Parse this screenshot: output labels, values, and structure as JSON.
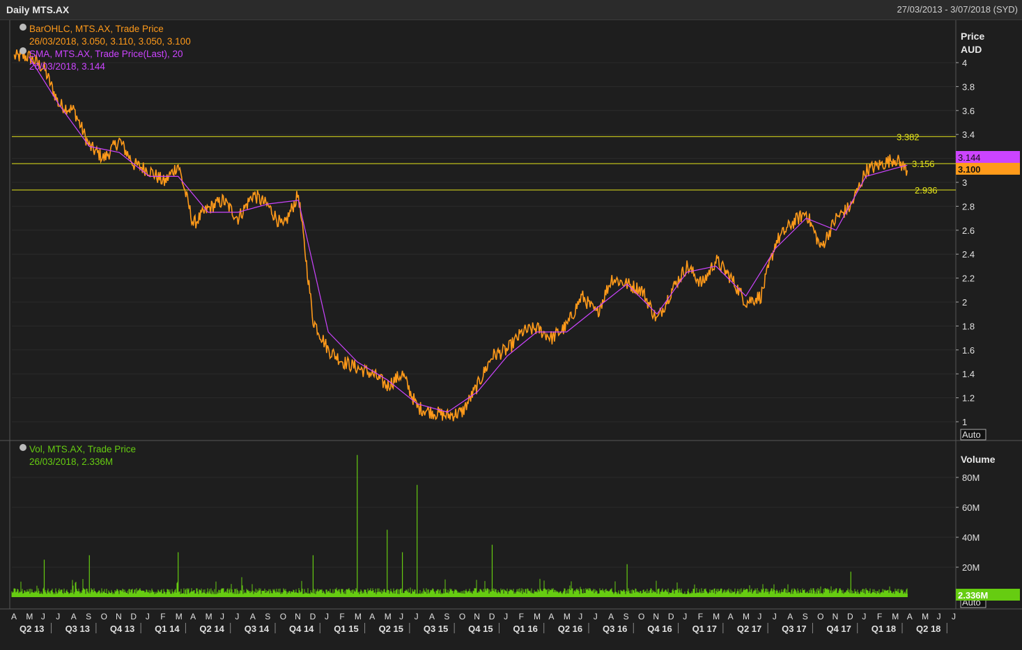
{
  "window": {
    "title": "Daily MTS.AX",
    "date_range": "27/03/2013 - 3/07/2018 (SYD)"
  },
  "colors": {
    "price": "#ff9a1a",
    "sma": "#cc44ff",
    "volume": "#66cc11",
    "hline": "#e6e61a",
    "volume_legend": "#66cc11",
    "bg": "#1e1e1e"
  },
  "price_panel": {
    "legend": {
      "ohlc_title": "BarOHLC, MTS.AX, Trade Price",
      "ohlc_values": "26/03/2018, 3.050, 3.110, 3.050, 3.100",
      "sma_title": "SMA, MTS.AX, Trade Price(Last),  20",
      "sma_values": "26/03/2018, 3.144"
    },
    "axis_title_1": "Price",
    "axis_title_2": "AUD",
    "auto_label": "Auto",
    "last_sma_tag": "3.144",
    "last_price_tag": "3.100",
    "hlines": [
      {
        "label": "3.382",
        "value": 3.382
      },
      {
        "label": "3.156",
        "value": 3.156
      },
      {
        "label": "2.936",
        "value": 2.936
      }
    ],
    "y_ticks": [
      "1",
      "1.2",
      "1.4",
      "1.6",
      "1.8",
      "2",
      "2.2",
      "2.4",
      "2.6",
      "2.8",
      "3",
      "3.2",
      "3.4",
      "3.6",
      "3.8",
      "4"
    ]
  },
  "volume_panel": {
    "legend_title": "Vol, MTS.AX, Trade Price",
    "legend_values": "26/03/2018, 2.336M",
    "axis_title": "Volume",
    "y_ticks": [
      "20M",
      "40M",
      "60M",
      "80M"
    ],
    "last_tag": "2.336M",
    "auto_label": "Auto"
  },
  "x_axis": {
    "months": [
      "A",
      "M",
      "J",
      "J",
      "A",
      "S",
      "O",
      "N",
      "D",
      "J",
      "F",
      "M",
      "A",
      "M",
      "J",
      "J",
      "A",
      "S",
      "O",
      "N",
      "D",
      "J",
      "F",
      "M",
      "A",
      "M",
      "J",
      "J",
      "A",
      "S",
      "O",
      "N",
      "D",
      "J",
      "F",
      "M",
      "A",
      "M",
      "J",
      "J",
      "A",
      "S",
      "O",
      "N",
      "D",
      "J",
      "F",
      "M",
      "A",
      "M",
      "J",
      "J",
      "A",
      "S",
      "O",
      "N",
      "D",
      "J",
      "F",
      "M",
      "A",
      "M",
      "J",
      "J"
    ],
    "quarters": [
      "Q2 13",
      "Q3 13",
      "Q4 13",
      "Q1 14",
      "Q2 14",
      "Q3 14",
      "Q4 14",
      "Q1 15",
      "Q2 15",
      "Q3 15",
      "Q4 15",
      "Q1 16",
      "Q2 16",
      "Q3 16",
      "Q4 16",
      "Q1 17",
      "Q2 17",
      "Q3 17",
      "Q4 17",
      "Q1 18",
      "Q2 18"
    ]
  },
  "chart_data": [
    {
      "type": "line",
      "title": "Daily MTS.AX",
      "ylabel": "Price AUD",
      "ylim": [
        0.95,
        4.1
      ],
      "x_range": [
        "2013-03-27",
        "2018-07-03"
      ],
      "series": [
        {
          "name": "BarOHLC, MTS.AX, Trade Price",
          "x": [
            "2013-04-01",
            "2013-05-01",
            "2013-06-01",
            "2013-07-01",
            "2013-08-01",
            "2013-09-01",
            "2013-10-01",
            "2013-11-01",
            "2013-12-01",
            "2014-01-01",
            "2014-02-01",
            "2014-03-01",
            "2014-04-01",
            "2014-05-01",
            "2014-06-01",
            "2014-07-01",
            "2014-08-01",
            "2014-09-01",
            "2014-10-01",
            "2014-11-01",
            "2014-12-01",
            "2015-01-01",
            "2015-02-01",
            "2015-03-01",
            "2015-04-01",
            "2015-05-01",
            "2015-06-01",
            "2015-07-01",
            "2015-08-01",
            "2015-09-01",
            "2015-10-01",
            "2015-11-01",
            "2015-12-01",
            "2016-01-01",
            "2016-02-01",
            "2016-03-01",
            "2016-04-01",
            "2016-05-01",
            "2016-06-01",
            "2016-07-01",
            "2016-08-01",
            "2016-09-01",
            "2016-10-01",
            "2016-11-01",
            "2016-12-01",
            "2017-01-01",
            "2017-02-01",
            "2017-03-01",
            "2017-04-01",
            "2017-05-01",
            "2017-06-01",
            "2017-07-01",
            "2017-08-01",
            "2017-09-01",
            "2017-10-01",
            "2017-11-01",
            "2017-12-01",
            "2018-01-01",
            "2018-02-01",
            "2018-03-01",
            "2018-03-26"
          ],
          "values": [
            4.3,
            4.2,
            3.95,
            3.65,
            3.6,
            3.3,
            3.2,
            3.35,
            3.15,
            3.1,
            3.0,
            3.15,
            2.65,
            2.78,
            2.85,
            2.7,
            2.9,
            2.8,
            2.62,
            2.9,
            1.85,
            1.6,
            1.5,
            1.45,
            1.4,
            1.3,
            1.4,
            1.12,
            1.08,
            1.05,
            1.08,
            1.3,
            1.55,
            1.6,
            1.75,
            1.78,
            1.7,
            1.8,
            2.05,
            1.9,
            2.2,
            2.15,
            2.1,
            1.85,
            2.1,
            2.3,
            2.15,
            2.35,
            2.2,
            2.0,
            2.05,
            2.5,
            2.65,
            2.75,
            2.45,
            2.7,
            2.8,
            3.1,
            3.15,
            3.2,
            3.1
          ]
        },
        {
          "name": "SMA, MTS.AX, Trade Price(Last),  20",
          "x": [
            "2013-05-01",
            "2013-07-01",
            "2013-09-01",
            "2013-11-01",
            "2014-01-01",
            "2014-03-01",
            "2014-05-01",
            "2014-07-01",
            "2014-09-01",
            "2014-11-01",
            "2015-01-01",
            "2015-03-01",
            "2015-05-01",
            "2015-07-01",
            "2015-09-01",
            "2015-11-01",
            "2016-01-01",
            "2016-03-01",
            "2016-05-01",
            "2016-07-01",
            "2016-09-01",
            "2016-11-01",
            "2017-01-01",
            "2017-03-01",
            "2017-05-01",
            "2017-07-01",
            "2017-09-01",
            "2017-11-01",
            "2018-01-01",
            "2018-03-26"
          ],
          "values": [
            4.05,
            3.65,
            3.3,
            3.25,
            3.05,
            3.05,
            2.75,
            2.75,
            2.82,
            2.85,
            1.75,
            1.5,
            1.35,
            1.15,
            1.08,
            1.25,
            1.55,
            1.75,
            1.75,
            1.95,
            2.15,
            1.9,
            2.25,
            2.3,
            2.05,
            2.45,
            2.7,
            2.6,
            3.05,
            3.144
          ]
        }
      ],
      "hlines": [
        3.382,
        3.156,
        2.936
      ]
    },
    {
      "type": "bar",
      "title": "Vol, MTS.AX, Trade Price",
      "ylabel": "Volume",
      "ylim": [
        0,
        90
      ],
      "y_unit": "M",
      "x": [
        "2013-06-01",
        "2013-09-01",
        "2014-03-01",
        "2014-12-01",
        "2015-03-01",
        "2015-05-01",
        "2015-06-01",
        "2015-07-01",
        "2015-12-01",
        "2016-09-01",
        "2017-12-01",
        "2018-03-26"
      ],
      "values": [
        25,
        28,
        30,
        28,
        95,
        45,
        30,
        75,
        35,
        22,
        17,
        2.336
      ]
    }
  ]
}
